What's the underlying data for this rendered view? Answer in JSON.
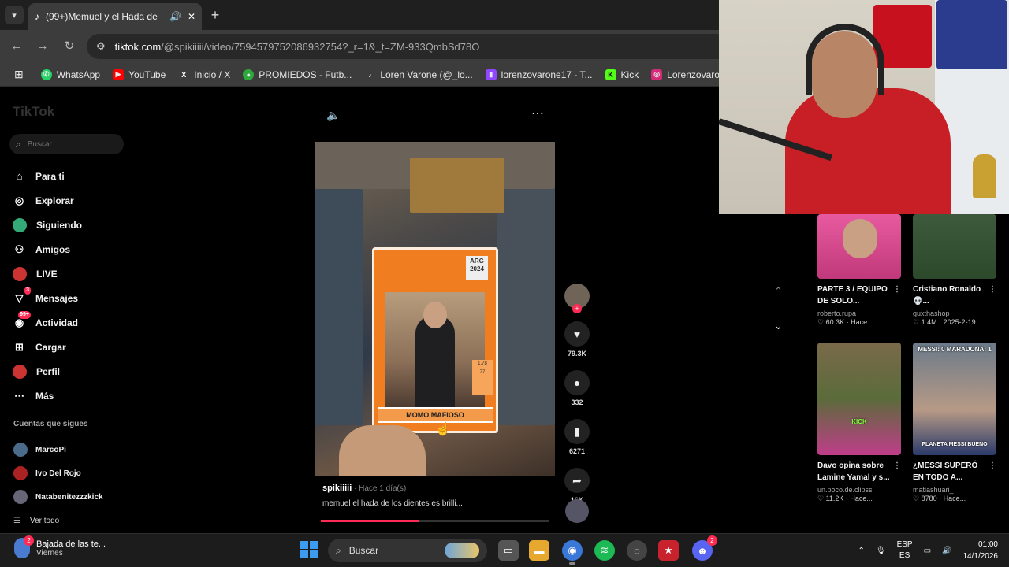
{
  "browser": {
    "tab": {
      "title": "(99+)Memuel y el Hada de"
    },
    "address": {
      "domain": "tiktok.com",
      "path": "/@spikiiiii/video/7594579752086932754?_r=1&_t=ZM-933QmbSd78O"
    },
    "bookmarks": [
      {
        "label": "WhatsApp",
        "icon": "whatsapp-icon",
        "color": "#25d366"
      },
      {
        "label": "YouTube",
        "icon": "youtube-icon",
        "color": "#ff0000"
      },
      {
        "label": "Inicio / X",
        "icon": "x-icon",
        "color": "#000000"
      },
      {
        "label": "PROMIEDOS - Futb...",
        "icon": "promiedos-icon",
        "color": "#2eaa3c"
      },
      {
        "label": "Loren Varone (@_lo...",
        "icon": "tiktok-icon",
        "color": "#111111"
      },
      {
        "label": "lorenzovarone17 - T...",
        "icon": "twitch-icon",
        "color": "#9146ff"
      },
      {
        "label": "Kick",
        "icon": "kick-icon",
        "color": "#53fc18"
      },
      {
        "label": "Lorenzovarone (Inst",
        "icon": "instagram-icon",
        "color": "#d62976"
      }
    ]
  },
  "tiktok": {
    "logo": "TikTok",
    "search_placeholder": "Buscar",
    "nav": [
      {
        "label": "Para ti",
        "icon": "home-icon"
      },
      {
        "label": "Explorar",
        "icon": "compass-icon"
      },
      {
        "label": "Siguiendo",
        "icon": "following-icon"
      },
      {
        "label": "Amigos",
        "icon": "friends-icon"
      },
      {
        "label": "LIVE",
        "icon": "live-icon"
      },
      {
        "label": "Mensajes",
        "icon": "messages-icon",
        "badge": "3"
      },
      {
        "label": "Actividad",
        "icon": "activity-icon",
        "badge": "99+"
      },
      {
        "label": "Cargar",
        "icon": "upload-icon"
      },
      {
        "label": "Perfil",
        "icon": "profile-icon"
      },
      {
        "label": "Más",
        "icon": "more-icon"
      }
    ],
    "following_title": "Cuentas que sigues",
    "following": [
      "MarcoPi",
      "Ivo Del Rojo",
      "Natabenitezzzkick"
    ],
    "see_all": "Ver todo",
    "video": {
      "card": {
        "country": "ARG",
        "year": "2024",
        "name": "MOMO MAFIOSO",
        "stats": [
          "1,78",
          "77"
        ]
      },
      "likes": "79.3K",
      "comments": "332",
      "saves": "6271",
      "shares": "16K",
      "author": "spikiiiii",
      "time": " · Hace 1 día(s)",
      "description": "memuel el hada de los dientes es brilli...",
      "progress": 0.43
    },
    "recommendations": [
      {
        "title": "PARTE 3 / EQUIPO DE SOLO...",
        "user": "roberto.rupa",
        "stats": "♡ 60.3K · Hace...",
        "thumb_text": ""
      },
      {
        "title": "Cristiano Ronaldo 💀...",
        "user": "guxthashop",
        "stats": "♡ 1.4M · 2025-2-19",
        "thumb_text": ""
      },
      {
        "title": "Davo opina sobre Lamine Yamal y s...",
        "user": "un.poco.de.clipss",
        "stats": "♡ 11.2K · Hace...",
        "thumb_text": "KICK"
      },
      {
        "title": "¿MESSI SUPERÓ EN TODO A...",
        "user": "matiashuari_",
        "stats": "♡ 8780 · Hace...",
        "thumb_text": "MESSI: 0 MARADONA: 1"
      }
    ],
    "rec4_bottom_text": "PLANETA MESSI BUENO"
  },
  "taskbar": {
    "notif_title": "Bajada de las te...",
    "notif_sub": "Viernes",
    "notif_badge": "2",
    "search_label": "Buscar",
    "lang_top": "ESP",
    "lang_bottom": "ES",
    "time": "01:00",
    "date": "14/1/2026",
    "discord_badge": "2"
  }
}
